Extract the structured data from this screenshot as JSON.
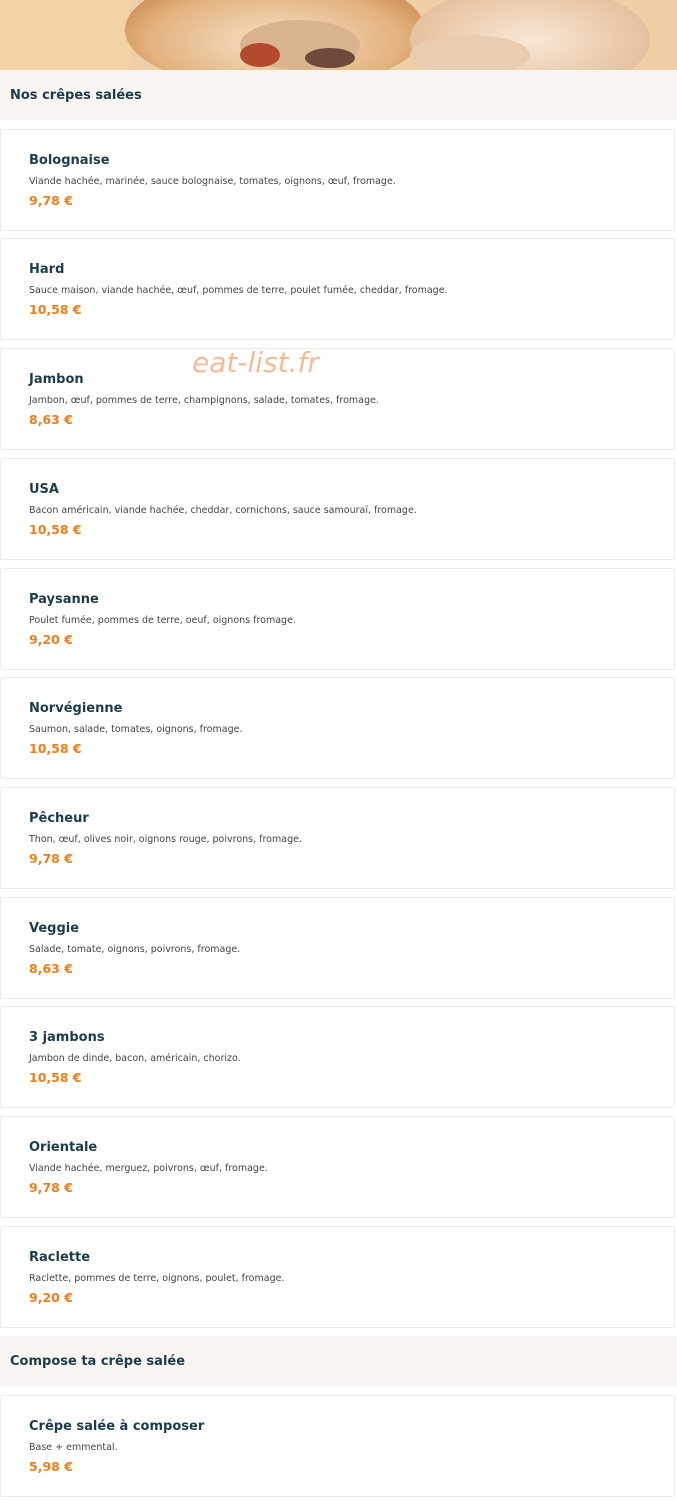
{
  "sections": [
    {
      "title": "Nos crêpes salées",
      "items": [
        {
          "name": "Bolognaise",
          "description": "Viande hachée, marinée, sauce bolognaise, tomates, oignons, œuf, fromage.",
          "price": "9,78 €"
        },
        {
          "name": "Hard",
          "description": "Sauce maison, viande hachée, œuf, pommes de terre, poulet fumée, cheddar, fromage.",
          "price": "10,58 €"
        },
        {
          "name": "Jambon",
          "description": "Jambon, œuf, pommes de terre, champignons, salade, tomates, fromage.",
          "price": "8,63 €"
        },
        {
          "name": "USA",
          "description": "Bacon américain, viande hachée, cheddar, cornichons, sauce samouraï, fromage.",
          "price": "10,58 €"
        },
        {
          "name": "Paysanne",
          "description": "Poulet fumée, pommes de terre, oeuf, oignons fromage.",
          "price": "9,20 €"
        },
        {
          "name": "Norvégienne",
          "description": "Saumon, salade, tomates, oignons, fromage.",
          "price": "10,58 €"
        },
        {
          "name": "Pêcheur",
          "description": "Thon, œuf, olives noir, oignons rouge, poivrons, fromage.",
          "price": "9,78 €"
        },
        {
          "name": "Veggie",
          "description": "Salade, tomate, oignons, poivrons, fromage.",
          "price": "8,63 €"
        },
        {
          "name": "3 jambons",
          "description": "Jambon de dinde, bacon, américain, chorizo.",
          "price": "10,58 €"
        },
        {
          "name": "Orientale",
          "description": "Viande hachée, merguez, poivrons, œuf, fromage.",
          "price": "9,78 €"
        },
        {
          "name": "Raclette",
          "description": "Raclette, pommes de terre, oignons, poulet, fromage.",
          "price": "9,20 €"
        }
      ]
    },
    {
      "title": "Compose ta crêpe salée",
      "items": [
        {
          "name": "Crêpe salée à composer",
          "description": "Base + emmental.",
          "price": "5,98 €"
        }
      ]
    }
  ],
  "watermark": "eat-list.fr",
  "colors": {
    "price": "#ef7d1a",
    "heading": "#1d3c4a",
    "section_bg": "#f8f5f2",
    "watermark": "#f2b48a"
  }
}
